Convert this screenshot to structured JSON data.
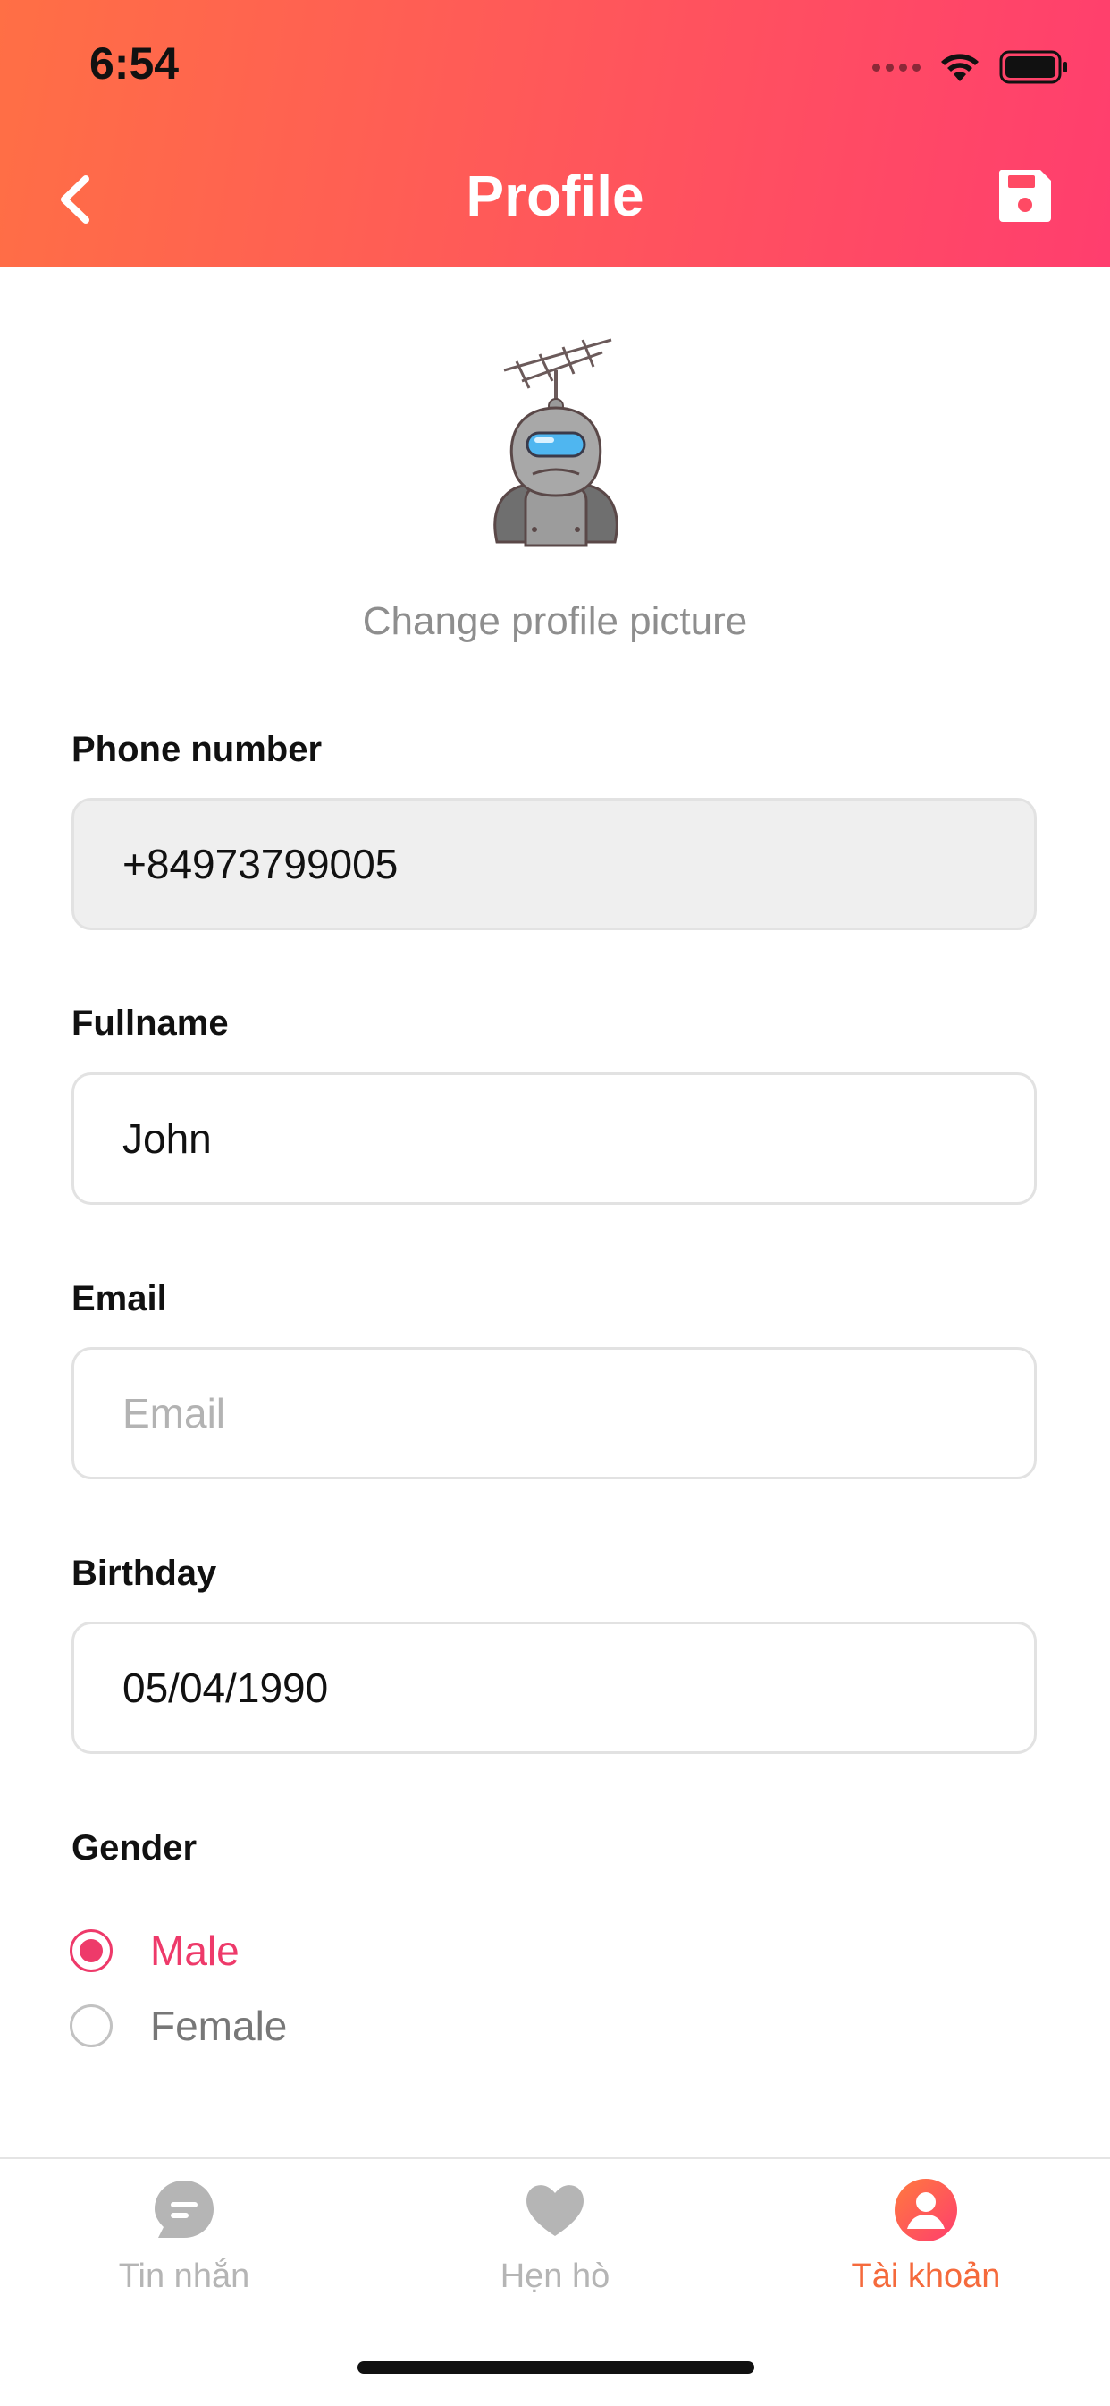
{
  "status_bar": {
    "time": "6:54",
    "icons": [
      "signal-icon",
      "wifi-icon",
      "battery-icon"
    ]
  },
  "nav": {
    "title": "Profile",
    "back_icon": "chevron-left-icon",
    "save_icon": "floppy-disk-icon"
  },
  "avatar": {
    "change_label": "Change profile picture"
  },
  "form": {
    "phone": {
      "label": "Phone number",
      "value": "+84973799005"
    },
    "fullname": {
      "label": "Fullname",
      "value": "John"
    },
    "email": {
      "label": "Email",
      "value": "",
      "placeholder": "Email"
    },
    "birthday": {
      "label": "Birthday",
      "value": "05/04/1990"
    },
    "gender": {
      "label": "Gender",
      "options": [
        {
          "label": "Male",
          "selected": true
        },
        {
          "label": "Female",
          "selected": false
        }
      ]
    }
  },
  "tabbar": {
    "items": [
      {
        "label": "Tin nhắn",
        "icon": "chat-bubble-icon",
        "active": false
      },
      {
        "label": "Hẹn hò",
        "icon": "heart-icon",
        "active": false
      },
      {
        "label": "Tài khoản",
        "icon": "user-icon",
        "active": true
      }
    ]
  },
  "colors": {
    "header_start": "#ff6f45",
    "header_end": "#ff3e6e",
    "accent_pink": "#ee3a6a",
    "active_tab": "#f56a3c"
  }
}
